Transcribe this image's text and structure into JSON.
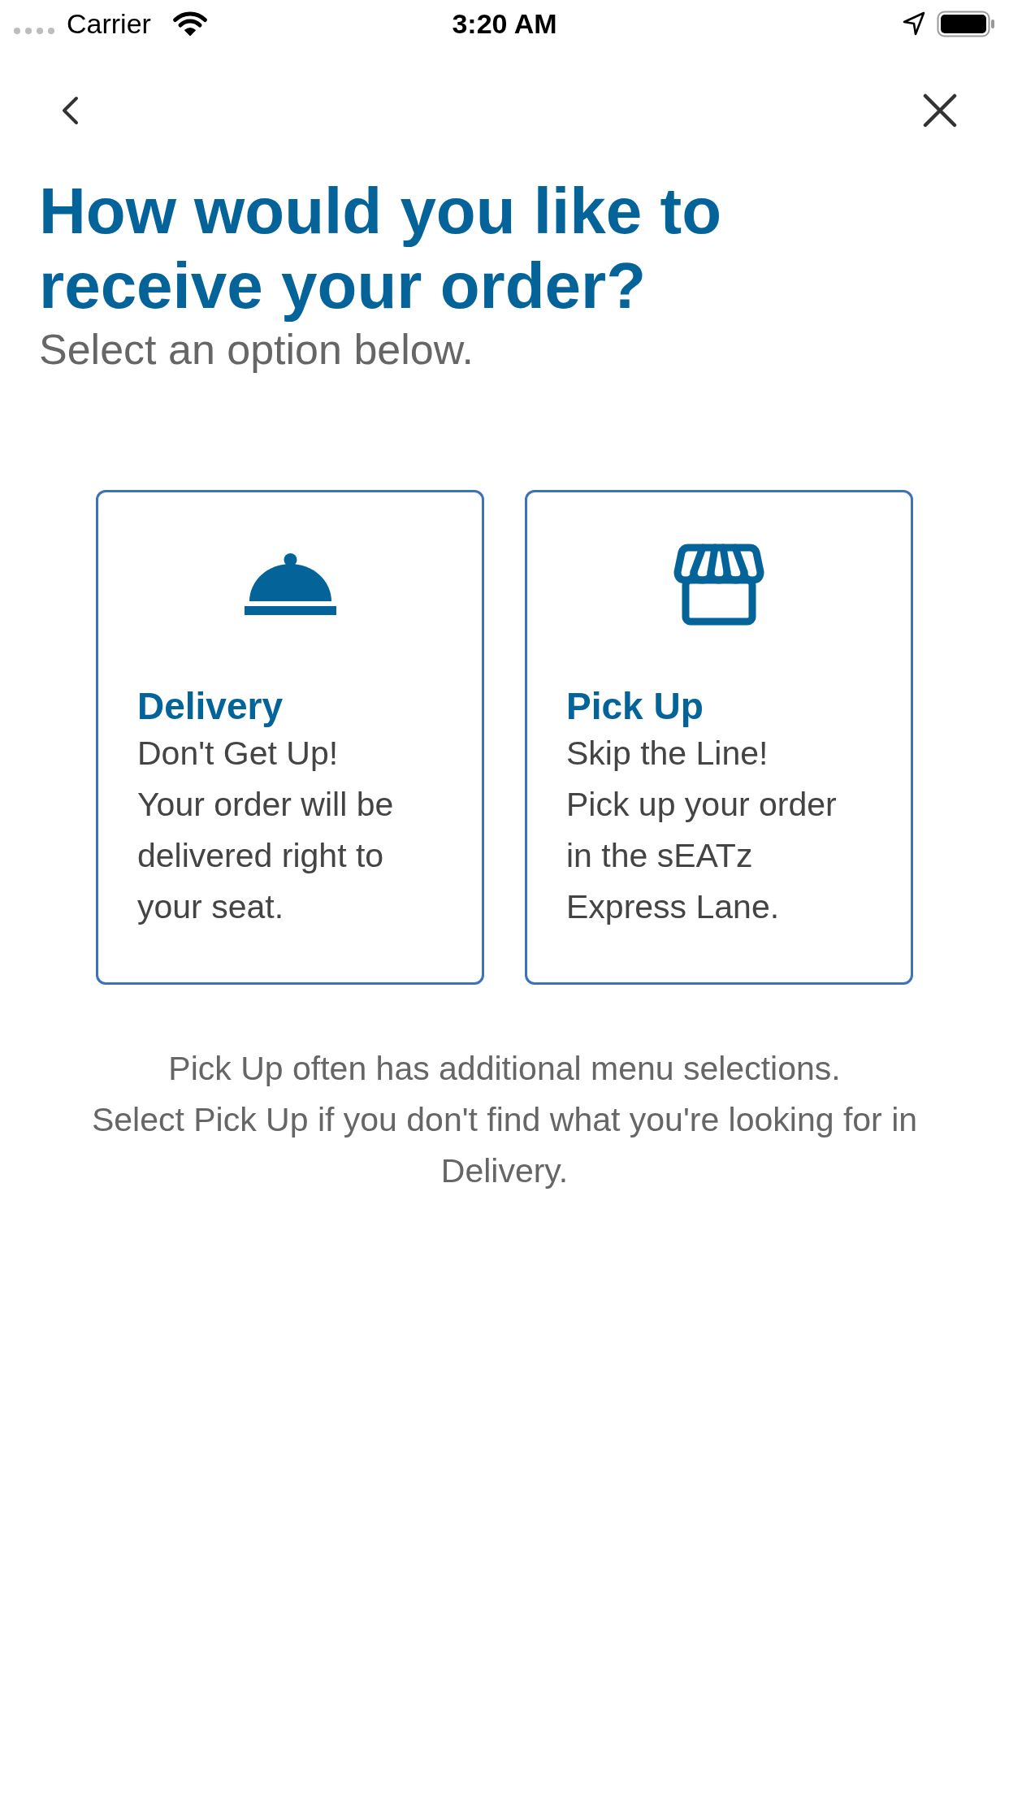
{
  "status_bar": {
    "carrier": "Carrier",
    "time": "3:20 AM"
  },
  "header": {
    "title": "How would you like to receive your order?",
    "subtitle": "Select an option below."
  },
  "options": [
    {
      "kind": "delivery",
      "title": "Delivery",
      "tagline": "Don't Get Up!",
      "description": "Your order will be delivered right to your seat."
    },
    {
      "kind": "pickup",
      "title": "Pick Up",
      "tagline": "Skip the Line!",
      "description": "Pick up your order in the sEATz Express Lane."
    }
  ],
  "notes": [
    "Pick Up often has additional menu selections.",
    "Select Pick Up if you don't find what you're looking for in Delivery."
  ]
}
